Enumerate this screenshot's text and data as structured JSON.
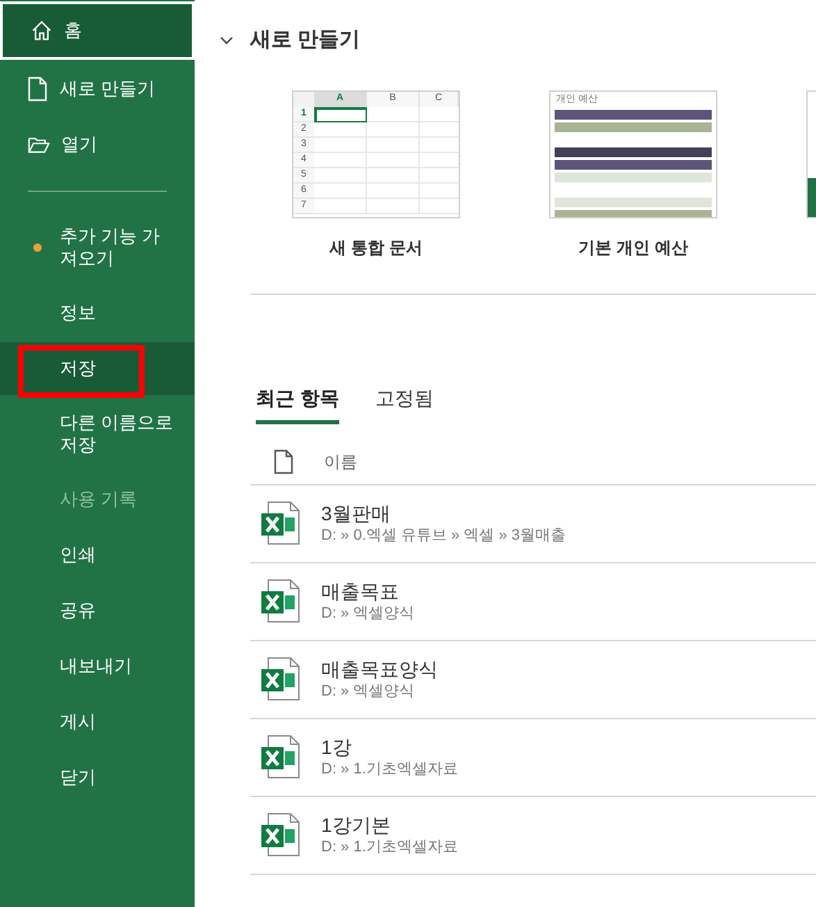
{
  "sidebar": {
    "items": [
      {
        "kind": "home",
        "label": "홈",
        "selected": true,
        "disabled": false,
        "highlighted": false,
        "badge": false
      },
      {
        "kind": "new",
        "label": "새로 만들기",
        "selected": false,
        "disabled": false,
        "highlighted": false,
        "badge": false
      },
      {
        "kind": "open",
        "label": "열기",
        "selected": false,
        "disabled": false,
        "highlighted": false,
        "badge": false
      },
      {
        "kind": "divider"
      },
      {
        "kind": "text",
        "label": "추가 기능 가져오기",
        "selected": false,
        "disabled": false,
        "highlighted": false,
        "badge": true
      },
      {
        "kind": "text",
        "label": "정보",
        "selected": false,
        "disabled": false,
        "highlighted": false,
        "badge": false
      },
      {
        "kind": "text",
        "label": "저장",
        "selected": false,
        "disabled": false,
        "highlighted": true,
        "badge": false
      },
      {
        "kind": "text",
        "label": "다른 이름으로 저장",
        "selected": false,
        "disabled": false,
        "highlighted": false,
        "badge": false
      },
      {
        "kind": "text",
        "label": "사용 기록",
        "selected": false,
        "disabled": true,
        "highlighted": false,
        "badge": false
      },
      {
        "kind": "text",
        "label": "인쇄",
        "selected": false,
        "disabled": false,
        "highlighted": false,
        "badge": false
      },
      {
        "kind": "text",
        "label": "공유",
        "selected": false,
        "disabled": false,
        "highlighted": false,
        "badge": false
      },
      {
        "kind": "text",
        "label": "내보내기",
        "selected": false,
        "disabled": false,
        "highlighted": false,
        "badge": false
      },
      {
        "kind": "text",
        "label": "게시",
        "selected": false,
        "disabled": false,
        "highlighted": false,
        "badge": false
      },
      {
        "kind": "text",
        "label": "닫기",
        "selected": false,
        "disabled": false,
        "highlighted": false,
        "badge": false
      }
    ]
  },
  "new_section": {
    "title": "새로 만들기",
    "expanded": true,
    "templates": [
      {
        "kind": "blank",
        "label": "새 통합 문서",
        "columns": [
          "A",
          "B",
          "C"
        ],
        "rows": [
          "1",
          "2",
          "3",
          "4",
          "5",
          "6",
          "7"
        ]
      },
      {
        "kind": "budget",
        "label": "기본 개인 예산",
        "title": "개인 예산"
      },
      {
        "kind": "partial"
      }
    ]
  },
  "recent": {
    "tabs": [
      {
        "label": "최근 항목",
        "selected": true
      },
      {
        "label": "고정됨",
        "selected": false
      }
    ],
    "column": "이름",
    "files": [
      {
        "name": "3월판매",
        "path": "D: » 0.엑셀 유튜브 » 엑셀 » 3월매출"
      },
      {
        "name": "매출목표",
        "path": "D: » 엑셀양식"
      },
      {
        "name": "매출목표양식",
        "path": "D: » 엑셀양식"
      },
      {
        "name": "1강",
        "path": "D: » 1.기초엑셀자료"
      },
      {
        "name": "1강기본",
        "path": "D: » 1.기초엑셀자료"
      }
    ]
  }
}
